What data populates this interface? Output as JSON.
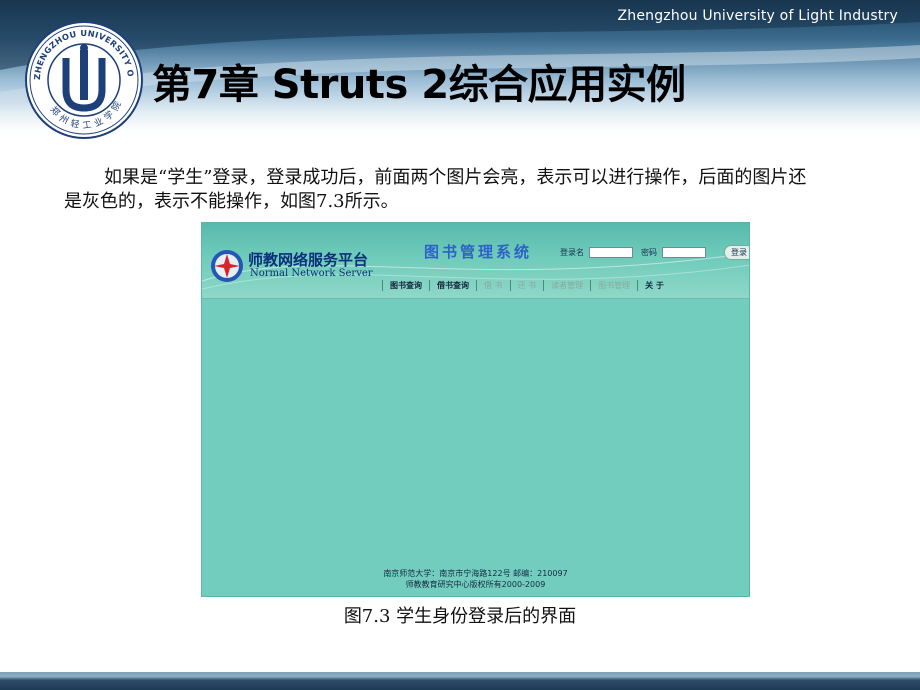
{
  "header": {
    "university": "Zhengzhou University of Light Industry",
    "logo": {
      "ring_text_top": "ZHENGZHOU UNIVERSITY OF LIGHT INDUSTRY",
      "ring_text_bottom": "郑州轻工业学院"
    }
  },
  "title": "第7章  Struts 2综合应用实例",
  "body_text": "如果是“学生”登录，登录成功后，前面两个图片会亮，表示可以进行操作，后面的图片还是灰色的，表示不能操作，如图7.3所示。",
  "figure": {
    "brand_cn": "师教网络服务平台",
    "brand_en": "Normal Network Server",
    "system_title": "图书管理系统",
    "login": {
      "username_label": "登录名",
      "password_label": "密码",
      "button_label": "登录"
    },
    "nav": [
      {
        "label": "图书查询",
        "state": "active"
      },
      {
        "label": "借书查询",
        "state": "active"
      },
      {
        "label": "借  书",
        "state": "disabled"
      },
      {
        "label": "还  书",
        "state": "disabled"
      },
      {
        "label": "读者管理",
        "state": "disabled"
      },
      {
        "label": "图书管理",
        "state": "disabled"
      },
      {
        "label": "关  于",
        "state": "active"
      }
    ],
    "footer_line1": "南京师范大学：南京市宁海路122号 邮编：210097",
    "footer_line2": "师教教育研究中心版权所有2000-2009"
  },
  "caption": "图7.3  学生身份登录后的界面",
  "colors": {
    "header_dark": "#1a3b57",
    "figure_background": "#72cdbf"
  }
}
